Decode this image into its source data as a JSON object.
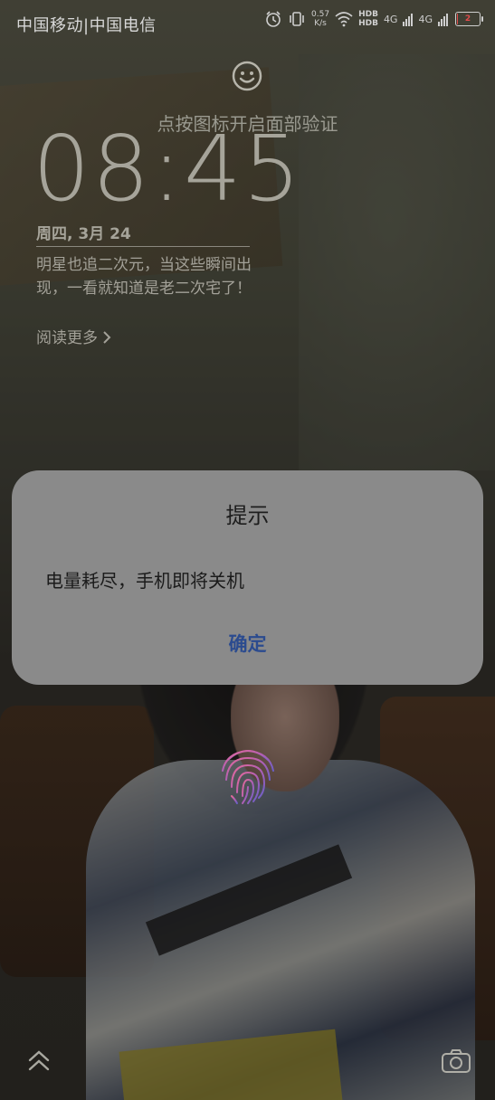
{
  "status_bar": {
    "carrier": "中国移动|中国电信",
    "net_speed_value": "0.57",
    "net_speed_unit": "K/s",
    "hd1": "HDB",
    "hd2": "HDB",
    "signal1_label": "4G",
    "signal2_label": "4G",
    "battery_percent": 2,
    "battery_label": "2",
    "battery_color": "#e34b4b"
  },
  "lockscreen": {
    "face_unlock_hint": "点按图标开启面部验证",
    "time": "08:45",
    "date": "周四, 3月 24",
    "headline": "明星也追二次元，当这些瞬间出现，一看就知道是老二次宅了！",
    "read_more": "阅读更多"
  },
  "dialog": {
    "title": "提示",
    "message": "电量耗尽，手机即将关机",
    "confirm_label": "确定",
    "confirm_color": "#2b4b8f"
  },
  "icons": {
    "face_unlock": "smiley-face-icon",
    "fingerprint": "fingerprint-icon",
    "unlock_up": "chevron-up-icon",
    "camera": "camera-icon"
  }
}
